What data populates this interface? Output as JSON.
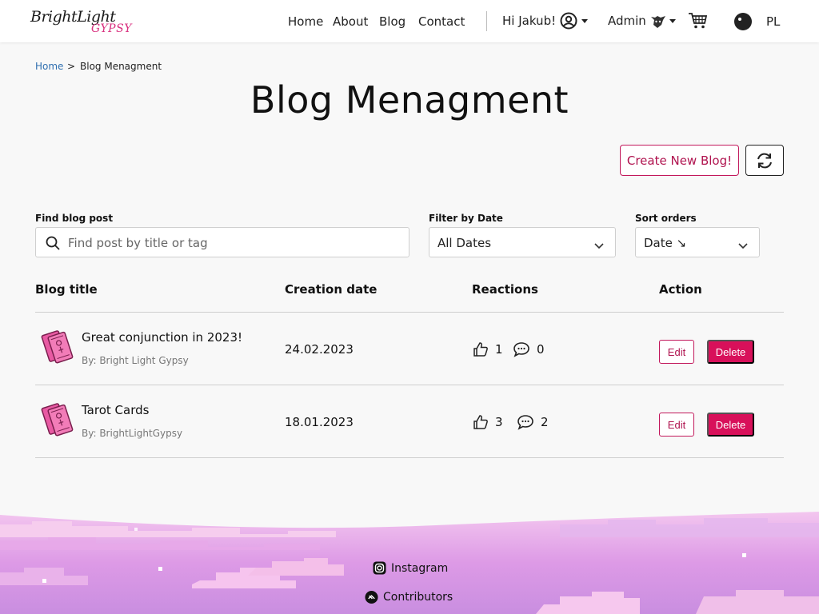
{
  "brand": {
    "line1": "BrightLight",
    "line2": "GYPSY"
  },
  "nav": {
    "links": [
      "Home",
      "About",
      "Blog",
      "Contact"
    ],
    "greeting": "Hi Jakub!",
    "admin": "Admin",
    "lang": "PL"
  },
  "breadcrumb": {
    "home": "Home",
    "separator": ">",
    "current": "Blog Menagment"
  },
  "page": {
    "title": "Blog Menagment",
    "create_label": "Create New Blog!"
  },
  "filters": {
    "search_label": "Find blog post",
    "search_placeholder": "Find post by title or tag",
    "date_label": "Filter by Date",
    "date_value": "All Dates",
    "sort_label": "Sort orders",
    "sort_value": "Date ↘"
  },
  "table": {
    "headers": [
      "Blog title",
      "Creation date",
      "Reactions",
      "Action"
    ],
    "rows": [
      {
        "title": "Great conjunction in 2023!",
        "author": "By: Bright Light Gypsy",
        "date": "24.02.2023",
        "likes": "1",
        "comments": "0",
        "edit": "Edit",
        "delete": "Delete"
      },
      {
        "title": "Tarot Cards",
        "author": "By: BrightLightGypsy",
        "date": "18.01.2023",
        "likes": "3",
        "comments": "2",
        "edit": "Edit",
        "delete": "Delete"
      }
    ]
  },
  "footer": {
    "instagram": "Instagram",
    "contributors": "Contributors"
  },
  "colors": {
    "accent": "#d8105a",
    "link": "#2f6fb0"
  }
}
